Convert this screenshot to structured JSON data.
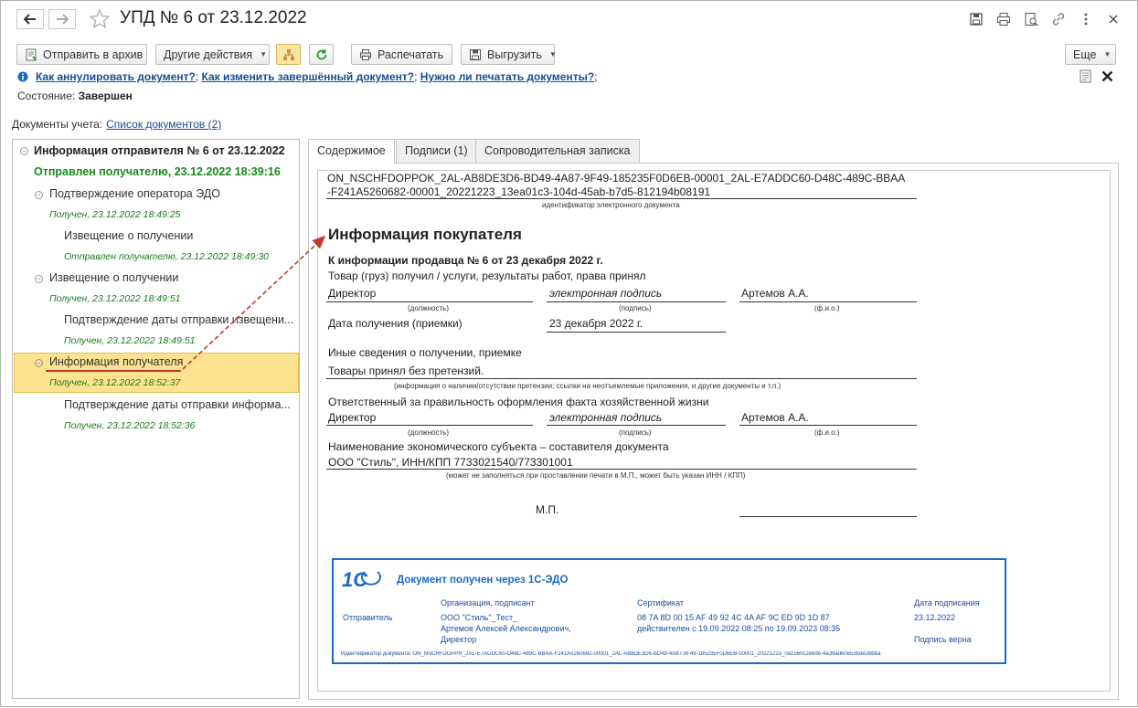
{
  "window": {
    "title": "УПД № 6 от 23.12.2022"
  },
  "toolbar": {
    "send_archive": "Отправить в архив",
    "other_actions": "Другие действия",
    "print": "Распечатать",
    "export": "Выгрузить",
    "more": "Еще"
  },
  "help_links": {
    "link1": "Как аннулировать документ?",
    "link2": "Как изменить завершённый документ?",
    "link3": "Нужно ли печатать документы?",
    "sep": ";"
  },
  "state": {
    "label": "Состояние:",
    "value": "Завершен"
  },
  "docs": {
    "label": "Документы учета:",
    "link": "Список документов (2)"
  },
  "tree": {
    "root": "Информация отправителя № 6 от 23.12.2022",
    "root_status": "Отправлен получателю, 23.12.2022 18:39:16",
    "items": [
      {
        "label": "Подтверждение оператора ЭДО",
        "status": "Получен, 23.12.2022 18:49:25"
      },
      {
        "label": "Извещение о получении",
        "status": "Отправлен получателю, 23.12.2022 18:49:30"
      },
      {
        "label": "Извещение о получении",
        "status": "Получен, 23.12.2022 18:49:51"
      },
      {
        "label": "Подтверждение даты отправки извещени...",
        "status": "Получен, 23.12.2022 18:49:51"
      },
      {
        "label": "Информация получателя",
        "status": "Получен, 23.12.2022 18:52:37"
      },
      {
        "label": "Подтверждение даты отправки информа...",
        "status": "Получен, 23.12.2022 18:52:36"
      }
    ]
  },
  "tabs": [
    "Содержимое",
    "Подписи (1)",
    "Сопроводительная записка"
  ],
  "document": {
    "id_line1": "ON_NSCHFDOPPOK_2AL-AB8DE3D6-BD49-4A87-9F49-185235F0D6EB-00001_2AL-E7ADDC60-D48C-489C-BBAA",
    "id_line2": "-F241A5260682-00001_20221223_13ea01c3-104d-45ab-b7d5-812194b08191",
    "id_caption": "идентификатор электронного документа",
    "heading": "Информация покупателя",
    "subheading": "К информации продавца № 6 от 23 декабря 2022 г.",
    "goods_received": "Товар (груз) получил / услуги, результаты работ, права принял",
    "position1": "Директор",
    "signature1": "электронная подпись",
    "name1": "Артемов А.А.",
    "cap_position": "(должность)",
    "cap_signature": "(подпись)",
    "cap_name": "(ф.и.о.)",
    "receipt_label": "Дата получения (приемки)",
    "receipt_date": "23 декабря 2022 г.",
    "other_info_label": "Иные сведения о получении, приемке",
    "other_info_value": "Товары принял без претензий.",
    "other_info_caption": "(информация о наличии/отсутствии претензии; ссылки на неотъемлемые приложения, и другие  документы и т.п.)",
    "responsible_label": "Ответственный за правильность оформления факта хозяйственной жизни",
    "position2": "Директор",
    "signature2": "электронная подпись",
    "name2": "Артемов А.А.",
    "entity_label": "Наименование экономического субъекта – составителя документа",
    "entity_value": "ООО \"Стиль\", ИНН/КПП 7733021540/773301001",
    "entity_caption": "(может не заполняться при проставлении печати в М.П., может быть указан ИНН / КПП)",
    "mp": "М.П."
  },
  "stamp": {
    "logo": "1С",
    "title": "Документ получен через 1С-ЭДО",
    "col_org": "Организация, подписант",
    "col_cert": "Сертификат",
    "col_date": "Дата подписания",
    "row_label": "Отправитель",
    "org_line1": "ООО \"Стиль\"_Тест_",
    "org_line2": "Артемов Алексей Александрович,",
    "org_line3": "Директор",
    "cert_line1": "08 7A 8D 00 15 AF 49 92 4C 4A AF 9C ED 9D 1D 87",
    "cert_line2": "действителен с 19.09.2022 08:25 по 19.09.2023 08:35",
    "sign_date": "23.12.2022",
    "sign_ok": "Подпись верна",
    "doc_id": "Идентификатор документа: ON_NSCHFDOPPR_2AL-E7ADDC60-D48C-489C-BBAA-F241A5260682-00001_2AL-AB8DE3D6-BD49-4A87-9F49-185235F0D6EB-00001_20221223_0a1560c2e6de-4a39ad60e53bde2bbba"
  },
  "colors": {
    "accent_link": "#1a4d8f",
    "status_green": "#1a8a1a",
    "selection": "#fde28f",
    "stamp_blue": "#1b6ac4",
    "arrow_red": "#c0392b"
  },
  "icons": [
    "back-arrow-icon",
    "forward-arrow-icon",
    "star-icon",
    "save-icon",
    "print-icon",
    "preview-icon",
    "link-icon",
    "more-vertical-icon",
    "close-icon",
    "archive-icon",
    "structure-icon",
    "refresh-icon",
    "printer-icon",
    "export-icon",
    "note-icon",
    "close-panel-icon"
  ]
}
